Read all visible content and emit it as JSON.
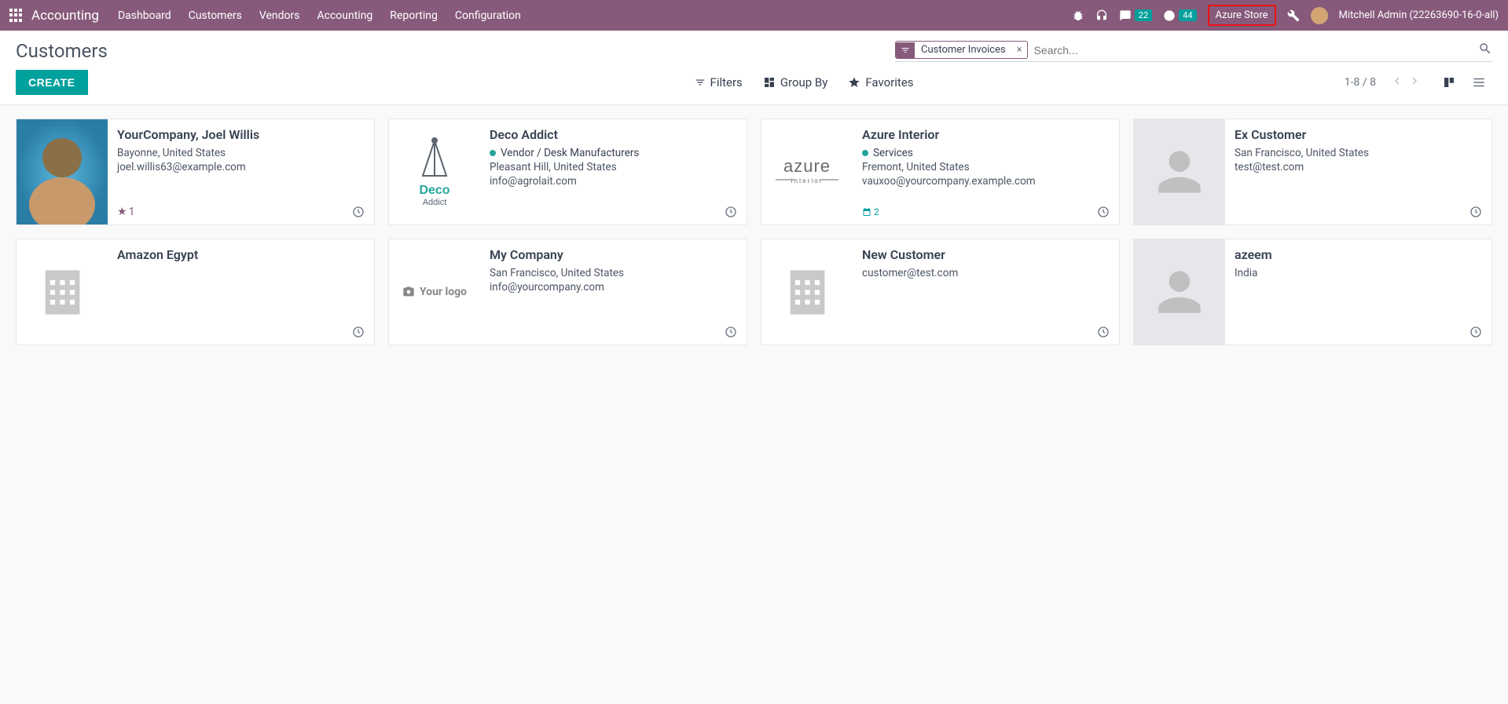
{
  "navbar": {
    "brand": "Accounting",
    "menu": [
      "Dashboard",
      "Customers",
      "Vendors",
      "Accounting",
      "Reporting",
      "Configuration"
    ],
    "messages_count": "22",
    "activities_count": "44",
    "company": "Azure Store",
    "user": "Mitchell Admin (22263690-16-0-all)"
  },
  "breadcrumb": "Customers",
  "search": {
    "facet_label": "Customer Invoices",
    "placeholder": "Search..."
  },
  "buttons": {
    "create": "CREATE"
  },
  "toolbar": {
    "filters": "Filters",
    "groupby": "Group By",
    "favorites": "Favorites",
    "pager": "1-8 / 8"
  },
  "customers": [
    {
      "name": "YourCompany, Joel Willis",
      "location": "Bayonne, United States",
      "email": "joel.willis63@example.com",
      "image": "photo",
      "star_count": "1",
      "tags": []
    },
    {
      "name": "Deco Addict",
      "location": "Pleasant Hill, United States",
      "email": "info@agrolait.com",
      "image": "deco",
      "tags": [
        {
          "text": "Vendor / Desk Manufacturers",
          "color": "green"
        }
      ]
    },
    {
      "name": "Azure Interior",
      "location": "Fremont, United States",
      "email": "vauxoo@yourcompany.example.com",
      "image": "azure",
      "tags": [
        {
          "text": "Services",
          "color": "green"
        }
      ],
      "activity_count": "2"
    },
    {
      "name": "Ex Customer",
      "location": "San Francisco, United States",
      "email": "test@test.com",
      "image": "person"
    },
    {
      "name": "Amazon Egypt",
      "image": "building"
    },
    {
      "name": "My Company",
      "location": "San Francisco, United States",
      "email": "info@yourcompany.com",
      "image": "yourlogo"
    },
    {
      "name": "New Customer",
      "email": "customer@test.com",
      "image": "building"
    },
    {
      "name": "azeem",
      "location": "India",
      "image": "person"
    }
  ]
}
